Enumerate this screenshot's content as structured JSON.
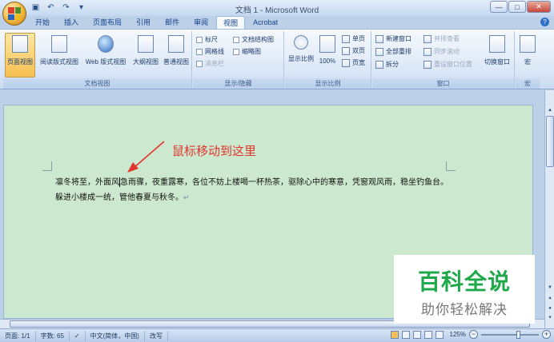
{
  "window": {
    "title": "文档 1 - Microsoft Word",
    "min_symbol": "—",
    "max_symbol": "□",
    "close_symbol": "✕"
  },
  "tabs": [
    "开始",
    "插入",
    "页面布局",
    "引用",
    "邮件",
    "审阅",
    "视图",
    "Acrobat"
  ],
  "active_tab": "视图",
  "ribbon": {
    "doc_views": {
      "label": "文档视图",
      "buttons": [
        "页面视图",
        "阅读版式视图",
        "Web 版式视图",
        "大纲视图",
        "普通视图"
      ]
    },
    "show_hide": {
      "label": "显示/隐藏",
      "checkboxes": [
        "标尺",
        "网格线",
        "消息栏",
        "文档结构图",
        "缩略图"
      ]
    },
    "zoom": {
      "label": "显示比例",
      "big_buttons": [
        "显示比例",
        "100%"
      ],
      "small_buttons": [
        "单页",
        "双页",
        "页宽"
      ]
    },
    "window_group": {
      "label": "窗口",
      "buttons": [
        "新建窗口",
        "全部重排",
        "拆分",
        "并排查看",
        "同步滚动",
        "重设窗口位置"
      ],
      "switch_label": "切换窗口"
    },
    "macro": {
      "label": "宏",
      "button": "宏"
    }
  },
  "document": {
    "annotation": "鼠标移动到这里",
    "text_before_cursor": "凛冬将至，外面风",
    "text_after_cursor": "急雨骤，夜重露寒，各位不妨上楼喝一杯热茶，驱除心中的寒意，凭窗观风雨，稳坐钓鱼台。躲进小楼成一统，管他春夏与秋冬。",
    "para_mark": "↵"
  },
  "statusbar": {
    "page": "页面: 1/1",
    "words": "字数: 65",
    "language": "中文(简体，中国)",
    "mode": "改写",
    "zoom": "125%"
  },
  "watermark": {
    "title": "百科全说",
    "subtitle": "助你轻松解决"
  },
  "colors": {
    "page_bg": "#cce8cf",
    "annotation": "#e0352b",
    "watermark_green": "#1ea84a"
  }
}
